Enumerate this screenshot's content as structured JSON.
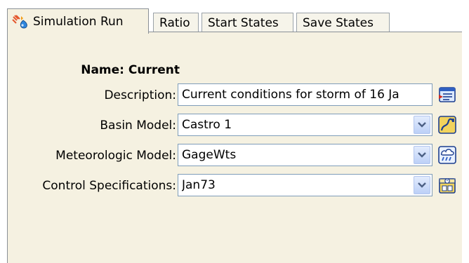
{
  "tabs": [
    {
      "label": "Simulation Run"
    },
    {
      "label": "Ratio"
    },
    {
      "label": "Start States"
    },
    {
      "label": "Save States"
    }
  ],
  "form": {
    "name_label": "Name:",
    "name_value": "Current",
    "description": {
      "label": "Description:",
      "value": "Current conditions for storm of 16 Ja"
    },
    "basin_model": {
      "label": "Basin Model:",
      "value": "Castro 1"
    },
    "meteorologic_model": {
      "label": "Meteorologic Model:",
      "value": "GageWts"
    },
    "control_specifications": {
      "label": "Control Specifications:",
      "value": "Jan73"
    }
  },
  "icons": {
    "active_tab": "simulation-run-icon",
    "description": "description-editor-icon",
    "basin": "basin-model-icon",
    "meteorologic": "meteorologic-model-icon",
    "control": "control-specifications-icon",
    "dropdown": "chevron-down-icon"
  },
  "colors": {
    "panel_bg": "#f5f1e1",
    "field_border": "#7f9db9",
    "tab_border": "#8a9096"
  }
}
